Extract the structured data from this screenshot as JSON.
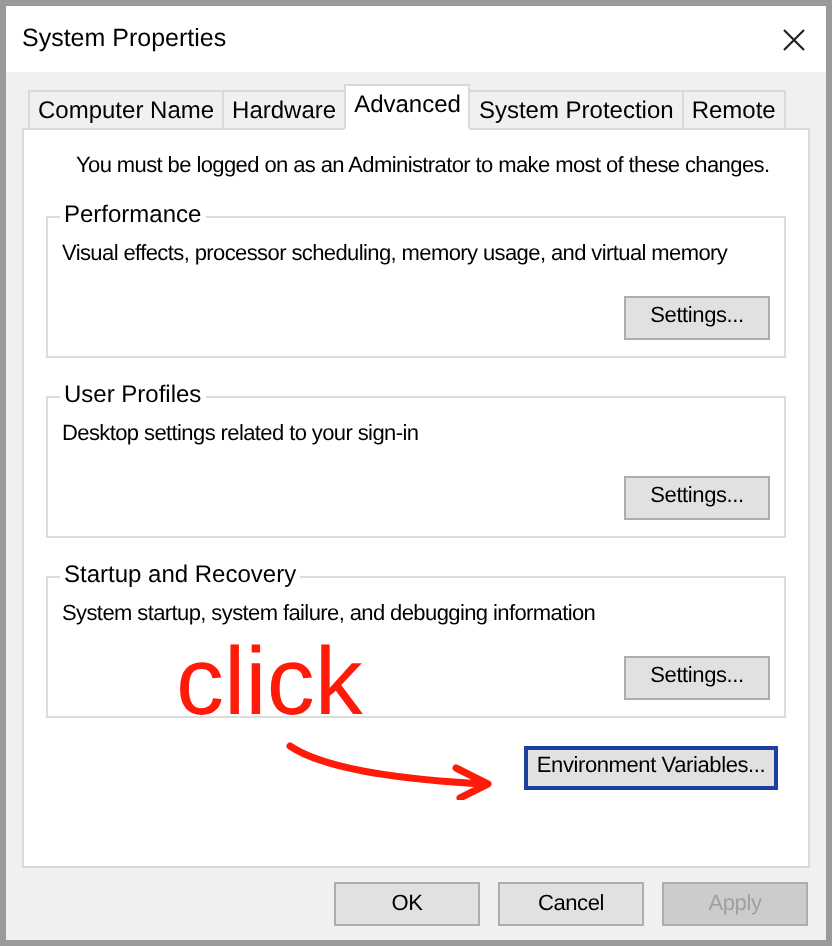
{
  "window": {
    "title": "System Properties"
  },
  "tabs": [
    {
      "label": "Computer Name",
      "selected": false
    },
    {
      "label": "Hardware",
      "selected": false
    },
    {
      "label": "Advanced",
      "selected": true
    },
    {
      "label": "System Protection",
      "selected": false
    },
    {
      "label": "Remote",
      "selected": false
    }
  ],
  "notice": "You must be logged on as an Administrator to make most of these changes.",
  "groups": [
    {
      "title": "Performance",
      "description": "Visual effects, processor scheduling, memory usage, and virtual memory",
      "button": "Settings..."
    },
    {
      "title": "User Profiles",
      "description": "Desktop settings related to your sign-in",
      "button": "Settings..."
    },
    {
      "title": "Startup and Recovery",
      "description": "System startup, system failure, and debugging information",
      "button": "Settings..."
    }
  ],
  "environment_button": {
    "label": "Environment Variables...",
    "focused": true
  },
  "annotation": {
    "text": "click"
  },
  "buttons": [
    {
      "label": "OK",
      "disabled": false
    },
    {
      "label": "Cancel",
      "disabled": false
    },
    {
      "label": "Apply",
      "disabled": true
    }
  ]
}
